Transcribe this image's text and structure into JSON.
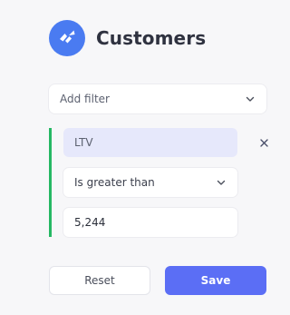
{
  "header": {
    "title": "Customers",
    "logo_color": "#4a7bf1"
  },
  "add_filter": {
    "label": "Add filter",
    "icon": "chevron-down-icon"
  },
  "filter": {
    "field": "LTV",
    "operator": "Is greater than",
    "value": "5,244",
    "remove_icon": "close-icon",
    "accent_color": "#25b863"
  },
  "actions": {
    "reset_label": "Reset",
    "save_label": "Save",
    "save_color": "#5b6ef5"
  }
}
